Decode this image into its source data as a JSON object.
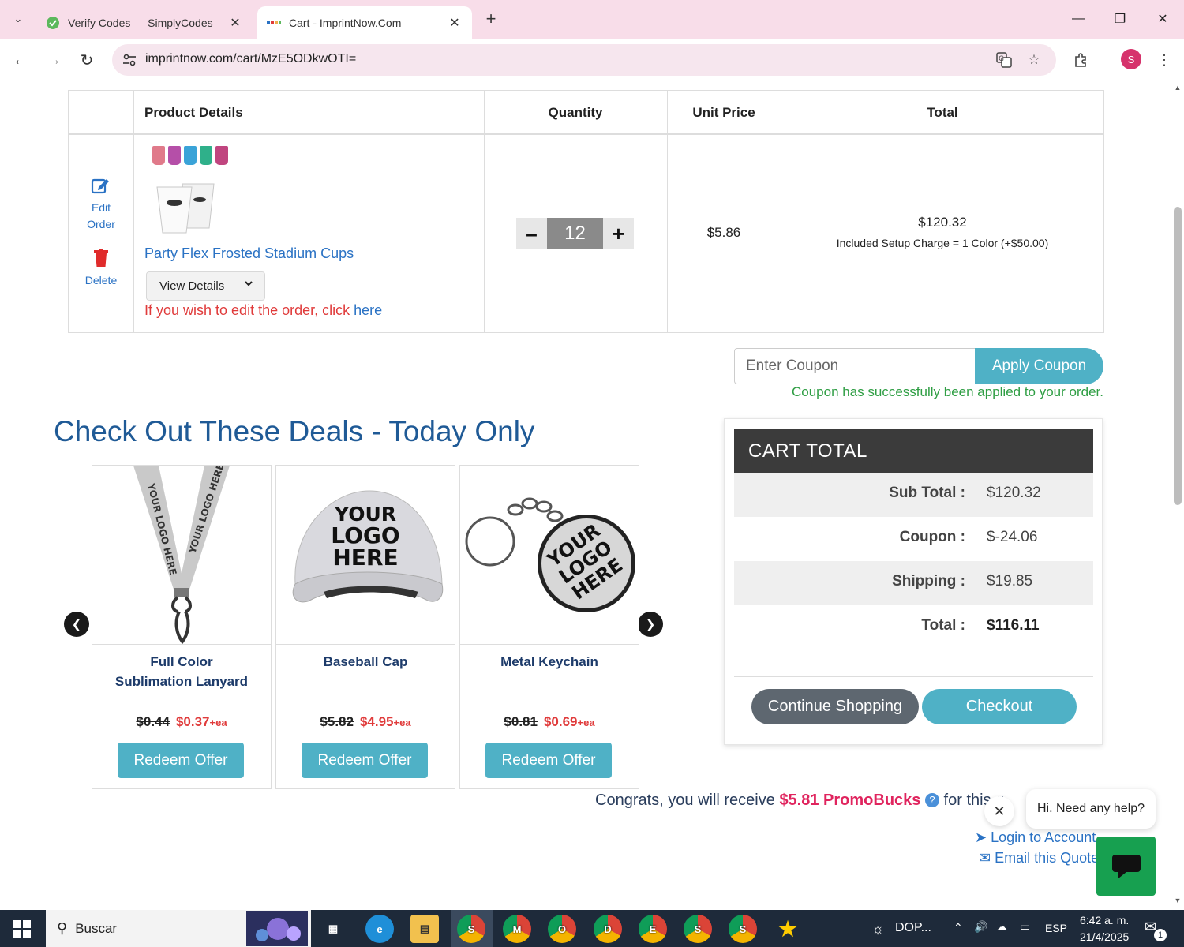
{
  "browser": {
    "tabs": [
      {
        "title": "Verify Codes — SimplyCodes",
        "active": false,
        "favicon": "simplycodes-icon"
      },
      {
        "title": "Cart - ImprintNow.Com",
        "active": true,
        "favicon": "imprintnow-icon"
      }
    ],
    "url": "imprintnow.com/cart/MzE5ODkwOTI=",
    "profile_initial": "S"
  },
  "cart_table": {
    "headers": {
      "product": "Product Details",
      "quantity": "Quantity",
      "unit_price": "Unit Price",
      "total": "Total"
    },
    "edit_label_1": "Edit",
    "edit_label_2": "Order",
    "delete_label": "Delete",
    "item": {
      "name": "Party Flex Frosted Stadium Cups",
      "view_details": "View Details",
      "edit_note": "If you wish to edit the order, click ",
      "edit_link": "here",
      "quantity": "12",
      "unit_price": "$5.86",
      "total": "$120.32",
      "setup_note": "Included Setup Charge = 1 Color (+$50.00)",
      "cup_colors": [
        "#e07a8a",
        "#b54fa8",
        "#3aa3d8",
        "#2fb08a",
        "#c0457f"
      ]
    }
  },
  "coupon": {
    "placeholder": "Enter Coupon",
    "apply_label": "Apply Coupon",
    "success_message": "Coupon has successfully been applied to your order."
  },
  "deals": {
    "title": "Check Out These Deals - Today Only",
    "items": [
      {
        "name_line1": "Full Color",
        "name_line2": "Sublimation Lanyard",
        "old_price": "$0.44",
        "new_price": "$0.37",
        "unit": "+ea",
        "button": "Redeem Offer",
        "logo_text": "YOUR LOGO HERE"
      },
      {
        "name_line1": "Baseball Cap",
        "name_line2": "",
        "old_price": "$5.82",
        "new_price": "$4.95",
        "unit": "+ea",
        "button": "Redeem Offer",
        "logo_text": "YOUR LOGO HERE"
      },
      {
        "name_line1": "Metal Keychain",
        "name_line2": "",
        "old_price": "$0.81",
        "new_price": "$0.69",
        "unit": "+ea",
        "button": "Redeem Offer",
        "logo_text": "YOUR LOGO HERE"
      }
    ]
  },
  "cart_total": {
    "title": "CART  TOTAL",
    "rows": [
      {
        "label": "Sub Total :",
        "value": "$120.32"
      },
      {
        "label": "Coupon :",
        "value": "$-24.06"
      },
      {
        "label": "Shipping :",
        "value": "$19.85"
      },
      {
        "label": "Total :",
        "value": "$116.11"
      }
    ],
    "continue_label": "Continue Shopping",
    "checkout_label": "Checkout"
  },
  "footer": {
    "congrats_prefix": "Congrats, you will receive ",
    "promobucks": "$5.81 PromoBucks",
    "congrats_suffix": " for this q",
    "login_label": "Login to Account",
    "email_label": "Email this Quote"
  },
  "chat": {
    "bubble_text": "Hi. Need any help?"
  },
  "taskbar": {
    "search_placeholder": "Buscar",
    "weather_text": "DOP...",
    "language": "ESP",
    "time": "6:42 a. m.",
    "date": "21/4/2025",
    "notification_count": "1",
    "chrome_profiles": [
      "S",
      "M",
      "O",
      "D",
      "E",
      "S",
      "S"
    ]
  }
}
